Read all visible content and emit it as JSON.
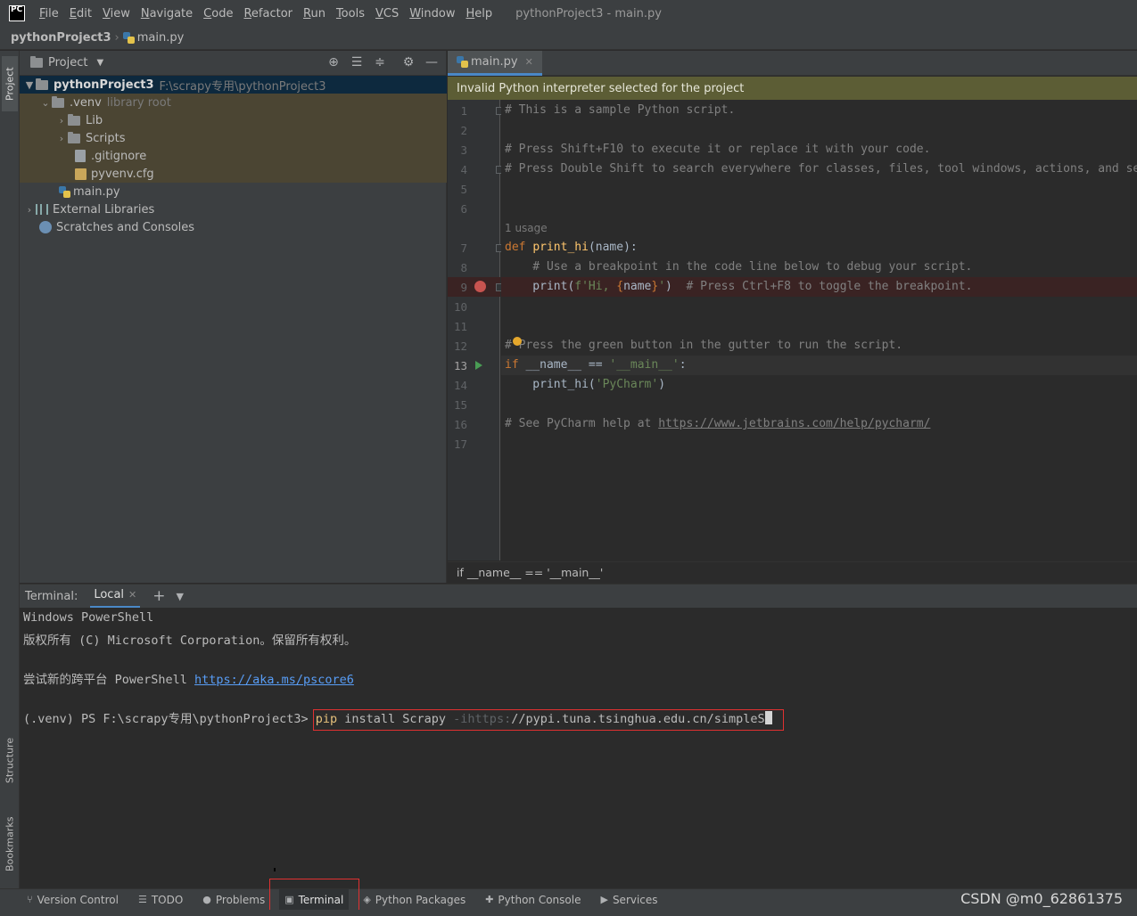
{
  "menubar": {
    "logo": "PC",
    "items": [
      "File",
      "Edit",
      "View",
      "Navigate",
      "Code",
      "Refactor",
      "Run",
      "Tools",
      "VCS",
      "Window",
      "Help"
    ],
    "window_title": "pythonProject3 - main.py"
  },
  "breadcrumb": {
    "project": "pythonProject3",
    "file": "main.py"
  },
  "left_strip": {
    "project_tab": "Project",
    "structure_tab": "Structure",
    "bookmarks_tab": "Bookmarks"
  },
  "project_panel": {
    "title": "Project",
    "tree": [
      {
        "label": "pythonProject3",
        "hint": "F:\\scrapy专用\\pythonProject3"
      },
      {
        "label": ".venv",
        "hint": "library root"
      },
      {
        "label": "Lib"
      },
      {
        "label": "Scripts"
      },
      {
        "label": ".gitignore"
      },
      {
        "label": "pyvenv.cfg"
      },
      {
        "label": "main.py"
      },
      {
        "label": "External Libraries"
      },
      {
        "label": "Scratches and Consoles"
      }
    ]
  },
  "editor": {
    "tab": "main.py",
    "warning": "Invalid Python interpreter selected for the project",
    "line_numbers": [
      "1",
      "2",
      "3",
      "4",
      "5",
      "6",
      "7",
      "8",
      "9",
      "10",
      "11",
      "12",
      "13",
      "14",
      "15",
      "16",
      "17"
    ],
    "usage_hint": "1 usage",
    "code": {
      "l1": "# This is a sample Python script.",
      "l3": "# Press Shift+F10 to execute it or replace it with your code.",
      "l4": "# Press Double Shift to search everywhere for classes, files, tool windows, actions, and settings.",
      "l7_kw": "def",
      "l7_fn": "print_hi",
      "l7_rest": "(name):",
      "l8": "    # Use a breakpoint in the code line below to debug your script.",
      "l9_a": "    print(",
      "l9_str1": "f'Hi, ",
      "l9_brace1": "{",
      "l9_var": "name",
      "l9_brace2": "}",
      "l9_str2": "'",
      "l9_b": ")  ",
      "l9_cm": "# Press Ctrl+F8 to toggle the breakpoint.",
      "l12": "# Press the green button in the gutter to run the script.",
      "l13_kw": "if",
      "l13_a": " __name__ == ",
      "l13_str": "'__main__'",
      "l13_b": ":",
      "l14_a": "    print_hi(",
      "l14_str": "'PyCharm'",
      "l14_b": ")",
      "l16_cm": "# See PyCharm help at ",
      "l16_link": "https://www.jetbrains.com/help/pycharm/"
    },
    "footer_breadcrumb": "if __name__ == '__main__'"
  },
  "terminal": {
    "label": "Terminal:",
    "tab": "Local",
    "lines": {
      "l1": "Windows PowerShell",
      "l2": "版权所有 (C) Microsoft Corporation。保留所有权利。",
      "l4_text": "尝试新的跨平台 PowerShell ",
      "l4_link": "https://aka.ms/pscore6",
      "prompt": "(.venv) PS F:\\scrapy专用\\pythonProject3> ",
      "cmd_pip": "pip",
      "cmd_mid": " install Scrapy ",
      "cmd_dim": "-ihttps:",
      "cmd_rest": "//pypi.tuna.tsinghua.edu.cn/simple",
      "cmd_last": "S"
    }
  },
  "bottom_bar": {
    "items": [
      "Version Control",
      "TODO",
      "Problems",
      "Terminal",
      "Python Packages",
      "Python Console",
      "Services"
    ],
    "watermark": "CSDN @m0_62861375"
  },
  "colors": {
    "accent": "#4a88c7",
    "highlight_box": "#e03131",
    "warning_bg": "#5c5d35",
    "breakpoint": "#c75450"
  }
}
